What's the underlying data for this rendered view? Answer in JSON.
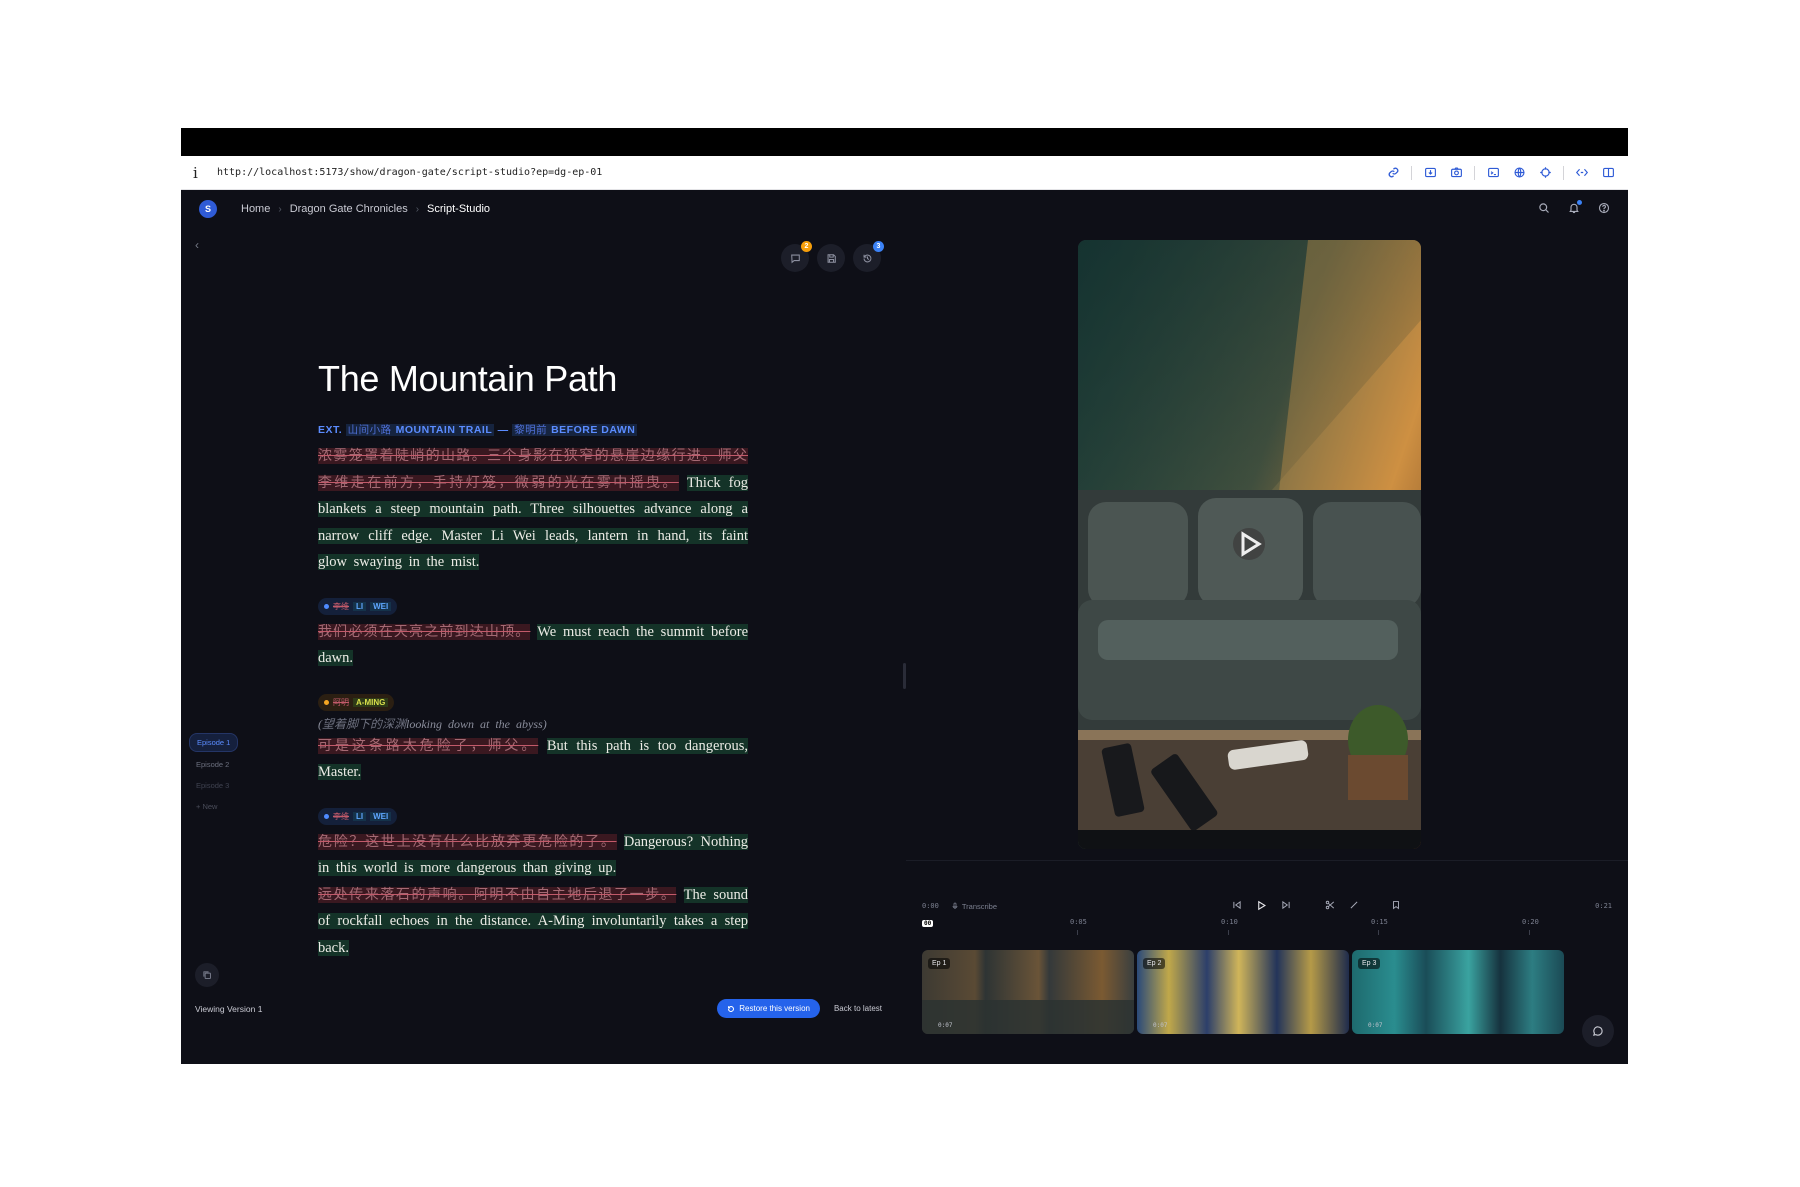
{
  "browser": {
    "info_glyph": "i",
    "url": "http://localhost:5173/show/dragon-gate/script-studio?ep=dg-ep-01",
    "tool_icons": [
      "link-icon",
      "download-icon",
      "camera-icon",
      "terminal-icon",
      "globe-icon",
      "crosshair-icon",
      "code-icon",
      "sidebar-icon"
    ]
  },
  "app": {
    "logo_letter": "S",
    "breadcrumbs": [
      "Home",
      "Dragon Gate Chronicles",
      "Script-Studio"
    ],
    "accent": "#2f5bd6"
  },
  "doc_actions": {
    "comments_badge": "2",
    "history_badge": "3"
  },
  "sidebar": {
    "episodes": [
      "Episode 1",
      "Episode 2",
      "Episode 3"
    ],
    "new_label": "+ New"
  },
  "script": {
    "title": "The Mountain Path",
    "scene": {
      "prefix": "EXT.",
      "cn_location": "山间小路",
      "location": "MOUNTAIN TRAIL",
      "dash": "—",
      "cn_time": "黎明前",
      "time": "BEFORE DAWN"
    },
    "action1": {
      "deleted": "浓雾笼罩着陡峭的山路。三个身影在狭窄的悬崖边缘行进。师父李维走在前方，手持灯笼，微弱的光在雾中摇曳。",
      "inserted": "Thick fog blankets a steep mountain path. Three silhouettes advance along a narrow cliff edge. Master Li Wei leads, lantern in hand, its faint glow swaying in the mist."
    },
    "line1": {
      "cn_name": "李维",
      "name_a": "LI",
      "name_b": "WEI",
      "deleted": "我们必须在天亮之前到达山顶。",
      "inserted": "We must reach the summit before dawn."
    },
    "line2": {
      "cn_name": "阿明",
      "name": "A-MING",
      "paren_open": "(",
      "paren_deleted": "望着脚下的深渊",
      "paren_inserted": "looking down at the abyss",
      "paren_close": ")",
      "deleted": "可是这条路太危险了，师父。",
      "inserted": "But this path is too dangerous, Master."
    },
    "line3": {
      "cn_name": "李维",
      "name_a": "LI",
      "name_b": "WEI",
      "deleted": "危险？这世上没有什么比放弃更危险的了。",
      "inserted": "Dangerous? Nothing in this world is more dangerous than giving up."
    },
    "action2": {
      "deleted": "远处传来落石的声响。阿明不由自主地后退了一步。",
      "inserted": "The sound of rockfall echoes in the distance. A-Ming involuntarily takes a step back."
    }
  },
  "version_bar": {
    "status": "Viewing Version 1",
    "restore_label": "Restore this version",
    "back_label": "Back to latest"
  },
  "timeline": {
    "current_time": "0:00",
    "transcribe_label": "Transcribe",
    "total_time": "0:21",
    "ticks": [
      "0:05",
      "0:10",
      "0:15",
      "0:20"
    ],
    "playhead_label": "00",
    "clips": [
      {
        "label": "Ep 1",
        "duration": "0:07"
      },
      {
        "label": "Ep 2",
        "duration": "0:07"
      },
      {
        "label": "Ep 3",
        "duration": "0:07"
      }
    ]
  }
}
